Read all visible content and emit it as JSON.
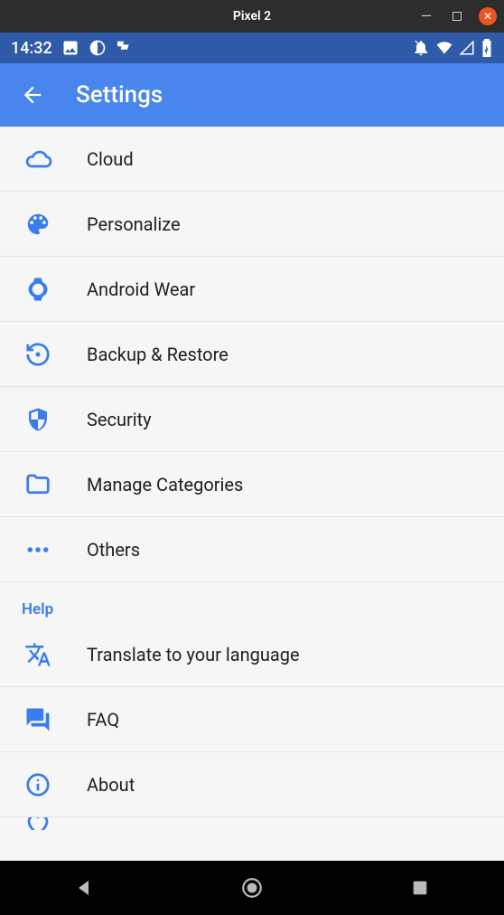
{
  "window": {
    "title": "Pixel 2"
  },
  "status_bar": {
    "time": "14:32"
  },
  "app_bar": {
    "title": "Settings"
  },
  "settings_items": [
    {
      "icon": "cloud",
      "label": "Cloud"
    },
    {
      "icon": "palette",
      "label": "Personalize"
    },
    {
      "icon": "watch",
      "label": "Android Wear"
    },
    {
      "icon": "restore",
      "label": "Backup & Restore"
    },
    {
      "icon": "shield",
      "label": "Security"
    },
    {
      "icon": "folder",
      "label": "Manage Categories"
    },
    {
      "icon": "dots",
      "label": "Others"
    }
  ],
  "section_help": {
    "title": "Help"
  },
  "help_items": [
    {
      "icon": "translate",
      "label": "Translate to your language"
    },
    {
      "icon": "chat",
      "label": "FAQ"
    },
    {
      "icon": "info",
      "label": "About"
    }
  ]
}
